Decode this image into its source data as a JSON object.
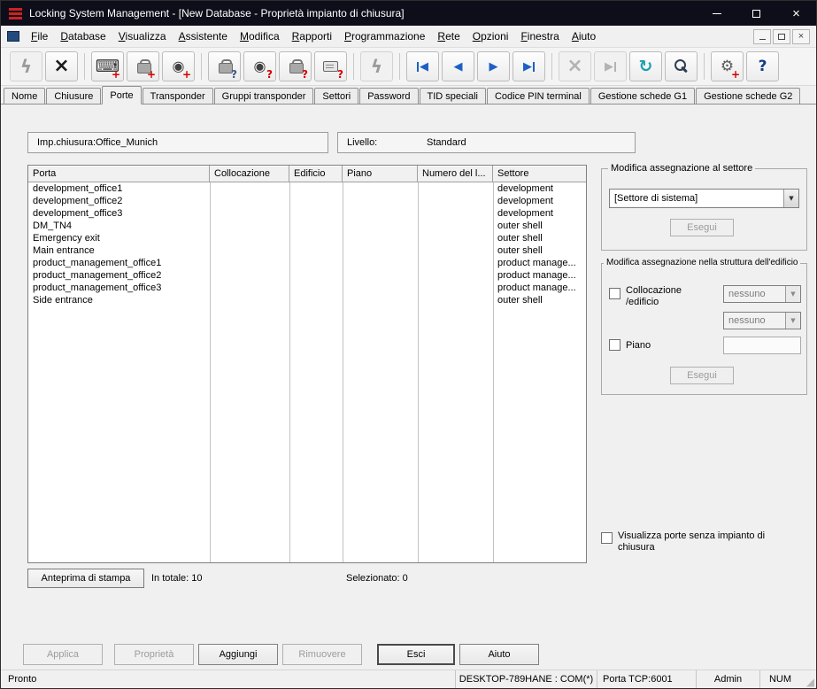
{
  "titlebar": {
    "title": "Locking System Management - [New Database - Proprietà impianto di chiusura]"
  },
  "icons": {
    "dropdown_arrow": "▼",
    "close": "×",
    "grip": "◢"
  },
  "menubar": {
    "items": [
      {
        "key": "F",
        "rest": "ile"
      },
      {
        "key": "D",
        "rest": "atabase"
      },
      {
        "key": "V",
        "rest": "isualizza"
      },
      {
        "key": "A",
        "rest": "ssistente"
      },
      {
        "key": "M",
        "rest": "odifica"
      },
      {
        "key": "R",
        "rest": "apporti"
      },
      {
        "key": "P",
        "rest": "rogrammazione"
      },
      {
        "key": "R",
        "rest": "ete"
      },
      {
        "key": "O",
        "rest": "pzioni"
      },
      {
        "key": "F",
        "rest": "inestra"
      },
      {
        "key": "A",
        "rest": "iuto"
      }
    ]
  },
  "toolbar": {
    "glyphs": {
      "lightning": "ϟ",
      "x": "×",
      "keyboard": "⌨",
      "transponder": "◉",
      "prev": "◀",
      "next": "▶",
      "refresh": "↻",
      "gear": "⚙",
      "help": "?"
    },
    "badges": {
      "add": "+",
      "question": "?"
    }
  },
  "tabs": [
    "Nome",
    "Chiusure",
    "Porte",
    "Transponder",
    "Gruppi transponder",
    "Settori",
    "Password",
    "TID speciali",
    "Codice PIN terminal",
    "Gestione schede G1",
    "Gestione schede G2"
  ],
  "active_tab": "Porte",
  "header_fields": {
    "lock_system_label": "Imp.chiusura:",
    "lock_system_value": "Office_Munich",
    "level_label": "Livello:",
    "level_value": "Standard"
  },
  "table": {
    "columns": [
      "Porta",
      "Collocazione",
      "Edificio",
      "Piano",
      "Numero del l...",
      "Settore"
    ],
    "rows": [
      {
        "porta": "development_office1",
        "settore": "development"
      },
      {
        "porta": "development_office2",
        "settore": "development"
      },
      {
        "porta": "development_office3",
        "settore": "development"
      },
      {
        "porta": "DM_TN4",
        "settore": "outer shell"
      },
      {
        "porta": "Emergency exit",
        "settore": "outer shell"
      },
      {
        "porta": "Main entrance",
        "settore": "outer shell"
      },
      {
        "porta": "product_management_office1",
        "settore": "product manage..."
      },
      {
        "porta": "product_management_office2",
        "settore": "product manage..."
      },
      {
        "porta": "product_management_office3",
        "settore": "product manage..."
      },
      {
        "porta": "Side entrance",
        "settore": "outer shell"
      }
    ],
    "footer": {
      "print_preview": "Anteprima di stampa",
      "total": "In totale: 10",
      "selected": "Selezionato: 0"
    }
  },
  "sector_group": {
    "title": "Modifica assegnazione al settore",
    "dropdown_value": "[Settore di sistema]",
    "execute": "Esegui"
  },
  "building_group": {
    "title": "Modifica assegnazione nella struttura dell'edificio",
    "location_label_line1": "Collocazione",
    "location_label_line2": "/edificio",
    "dropdown1_value": "nessuno",
    "dropdown2_value": "nessuno",
    "floor_label": "Piano",
    "floor_value": "",
    "execute": "Esegui"
  },
  "options": {
    "show_without_system": "Visualizza porte senza impianto di chiusura"
  },
  "buttons": {
    "apply": "Applica",
    "properties": "Proprietà",
    "add": "Aggiungi",
    "remove": "Rimuovere",
    "exit": "Esci",
    "help": "Aiuto"
  },
  "statusbar": {
    "ready": "Pronto",
    "connection": "DESKTOP-789HANE : COM(*)",
    "tcp_port": "Porta TCP:6001",
    "user": "Admin",
    "num_lock": "NUM"
  }
}
